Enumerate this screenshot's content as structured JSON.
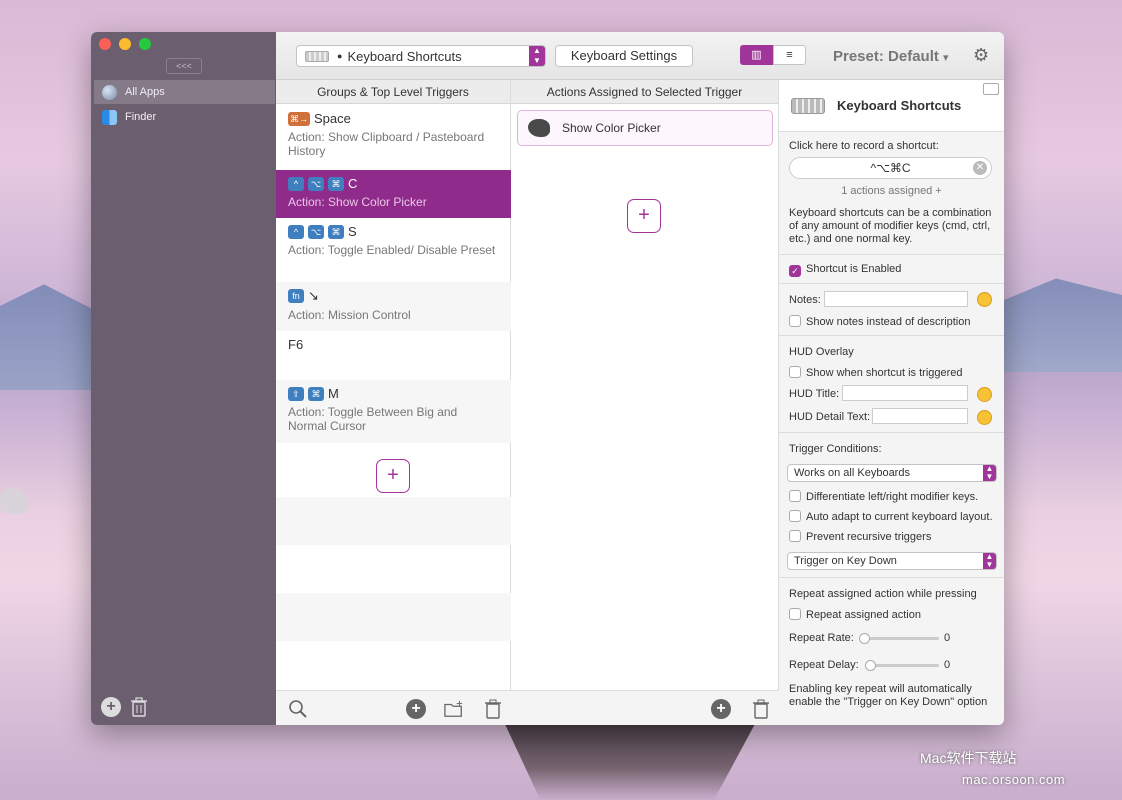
{
  "sidebar": {
    "collapse_label": "<<<",
    "apps": [
      {
        "label": "All Apps",
        "icon": "globe-icon"
      },
      {
        "label": "Finder",
        "icon": "finder-icon"
      }
    ]
  },
  "toolbar": {
    "trigger_type": "Keyboard Shortcuts",
    "settings_label": "Keyboard Settings",
    "preset_label": "Preset: Default",
    "preset_arrow": "▾",
    "view_grid_icon": "columns-view-icon",
    "view_list_icon": "list-view-icon"
  },
  "triggers": {
    "header": "Groups & Top Level Triggers",
    "items": [
      {
        "key": "Space",
        "action": "Action: Show Clipboard / Pasteboard History"
      },
      {
        "key": "C",
        "action": "Action: Show Color Picker"
      },
      {
        "key": "S",
        "action": "Action: Toggle Enabled/ Disable Preset"
      },
      {
        "key": "↘",
        "action": "Action: Mission Control"
      },
      {
        "key": "F6",
        "action": ""
      },
      {
        "key": "M",
        "action": "Action: Toggle Between Big and Normal Cursor"
      }
    ],
    "add_label": "+"
  },
  "actions": {
    "header": "Actions Assigned to Selected Trigger",
    "items": [
      {
        "label": "Show Color Picker"
      }
    ],
    "add_label": "+"
  },
  "detail": {
    "title": "Keyboard Shortcuts",
    "record_label": "Click here to record a shortcut:",
    "shortcut_value": "^⌥⌘C",
    "actions_assigned": "1 actions assigned +",
    "description": "Keyboard shortcuts can be a combination of any amount of modifier keys (cmd, ctrl, etc.) and one normal key.",
    "enabled_label": "Shortcut is Enabled",
    "notes_label": "Notes:",
    "show_notes_label": "Show notes instead of description",
    "hud_header": "HUD Overlay",
    "hud_show_label": "Show when shortcut is triggered",
    "hud_title_label": "HUD Title:",
    "hud_detail_label": "HUD Detail Text:",
    "conditions_header": "Trigger Conditions:",
    "keyboards_option": "Works on all Keyboards",
    "diff_label": "Differentiate left/right modifier keys.",
    "adapt_label": "Auto adapt to current keyboard layout.",
    "recursive_label": "Prevent recursive triggers",
    "trigger_on_option": "Trigger on Key Down",
    "repeat_header": "Repeat assigned action while pressing",
    "repeat_label": "Repeat assigned action",
    "repeat_rate_label": "Repeat Rate:",
    "repeat_rate_value": "0",
    "repeat_delay_label": "Repeat Delay:",
    "repeat_delay_value": "0",
    "repeat_note": "Enabling key repeat will automatically enable the \"Trigger on Key Down\" option"
  },
  "watermark": {
    "line1": "Mac软件下载站",
    "line2": "mac.orsoon.com"
  },
  "colors": {
    "accent": "#a0359a",
    "selected_row": "#8f2b8b",
    "sidebar_bg": "#6b5f6f"
  }
}
